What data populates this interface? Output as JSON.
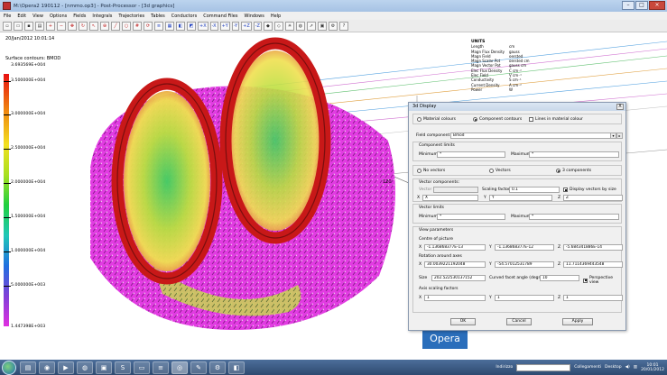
{
  "window": {
    "title": "M:\\Opera2 190112 - [nmmo.op3] - Post-Processor - [3d graphics]"
  },
  "menu": [
    "File",
    "Edit",
    "View",
    "Options",
    "Fields",
    "Integrals",
    "Trajectories",
    "Tables",
    "Conductors",
    "Command Files",
    "Windows",
    "Help"
  ],
  "toolbar": [
    "+X",
    "-X",
    "+Y",
    "-Y",
    "+Z",
    "-Z"
  ],
  "viewport": {
    "timestamp": "20/Jan/2012 10:01:14",
    "contour_title": "Surface contours: BMOD",
    "legend_values": [
      "3.693569E+004",
      "3.500000E+004",
      "3.000000E+004",
      "2.500000E+004",
      "2.000000E+004",
      "1.500000E+004",
      "1.000000E+004",
      "5.000000E+003",
      "1.447398E+003"
    ],
    "axis_marker": "120"
  },
  "units": {
    "heading": "UNITS",
    "rows": [
      {
        "name": "Length",
        "value": "cm"
      },
      {
        "name": "Magn Flux Density",
        "value": "gauss"
      },
      {
        "name": "Magn Field",
        "value": "oersted"
      },
      {
        "name": "Magn Scalar Pot",
        "value": "oersted cm"
      },
      {
        "name": "Magn Vector Pot",
        "value": "gauss cm"
      },
      {
        "name": "Elec Flux Density",
        "value": "C cm⁻²"
      },
      {
        "name": "Elec Field",
        "value": "V cm⁻¹"
      },
      {
        "name": "Conductivity",
        "value": "S cm⁻¹"
      },
      {
        "name": "Current Density",
        "value": "A cm⁻²"
      },
      {
        "name": "Power",
        "value": "W"
      }
    ]
  },
  "dialog": {
    "title": "3d Display",
    "close": "X",
    "color_mode": [
      "Material colours",
      "Component contours",
      "Lines in material colour"
    ],
    "field_component_label": "Field component",
    "field_component_value": "Bmod",
    "component_limits_label": "Component limits",
    "minimum_label": "Minimum:",
    "minimum_value": "*",
    "maximum_label": "Maximum:",
    "maximum_value": "*",
    "vector_mode": [
      "No vectors",
      "Vectors",
      "3 components"
    ],
    "vector_components_label": "Vector components:",
    "vector_label": "Vector",
    "scaling_factor_label": "Scaling factor",
    "scaling_factor_value": "0.1",
    "display_by_size_label": "Display vectors by size",
    "x_label": "X",
    "x_value": "X",
    "y_label": "Y",
    "y_value": "Y",
    "z_label": "Z",
    "z_value": "Z",
    "vector_limits_label": "Vector limits",
    "vmin_label": "Minimum:",
    "vmin_value": "*",
    "vmax_label": "Maximum:",
    "vmax_value": "*",
    "view_params_label": "View parameters",
    "centre_label": "Centre of picture",
    "cx_value": "-1.136868377E-13",
    "cy_value": "-1.136868377E-12",
    "cz_value": "-5.684341886E-14",
    "rotation_label": "Rotation around axes",
    "rx_value": "30.0039221192048",
    "ry_value": "-54.57012531789",
    "rz_value": "11.7114369443548",
    "size_label": "Size",
    "size_value": "202.522530137152",
    "facet_label": "Curved facet angle (degrees)",
    "facet_value": "10",
    "perspective_label": "Perspective view",
    "axis_scaling_label": "Axis scaling factors",
    "sx_value": "1",
    "sy_value": "1",
    "sz_value": "1",
    "ok": "OK",
    "cancel": "Cancel",
    "apply": "Apply"
  },
  "logo": "Opera",
  "taskbar": {
    "address_label": "Indirizzo",
    "links_label": "Collegamenti",
    "desktop_label": "Desktop",
    "time": "10:01",
    "date": "20/01/2012"
  },
  "colors": {
    "titlebar": "#a6c2e4",
    "taskbar": "#2e4a70",
    "opera_blue": "#2a6ebb",
    "ring_red": "#c81818",
    "vector_magenta": "#e030e0"
  }
}
